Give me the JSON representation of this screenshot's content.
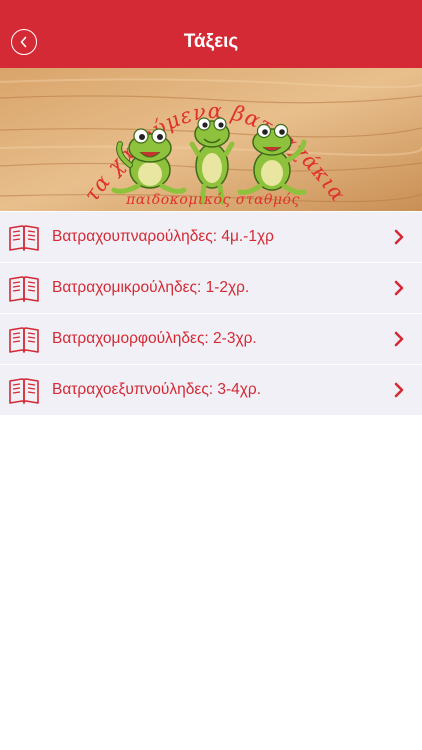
{
  "nav": {
    "title": "Τάξεις",
    "back_icon": "chevron-left-icon"
  },
  "banner": {
    "title_text": "τα χαρούμενα βατραχάκια",
    "subtitle_text": "παιδοκομικός σταθμός"
  },
  "classes": [
    {
      "label": "Βατραχουπναρούληδες: 4μ.-1χρ",
      "icon": "book-icon"
    },
    {
      "label": "Βατραχομικρούληδες: 1-2χρ.",
      "icon": "book-icon"
    },
    {
      "label": "Βατραχομορφούληδες: 2-3χρ.",
      "icon": "book-icon"
    },
    {
      "label": "Βατραχοεξυπνούληδες: 3-4χρ.",
      "icon": "book-icon"
    }
  ],
  "colors": {
    "accent": "#d42a35",
    "list_background": "#f0f0f6",
    "page_background": "#ffffff"
  }
}
